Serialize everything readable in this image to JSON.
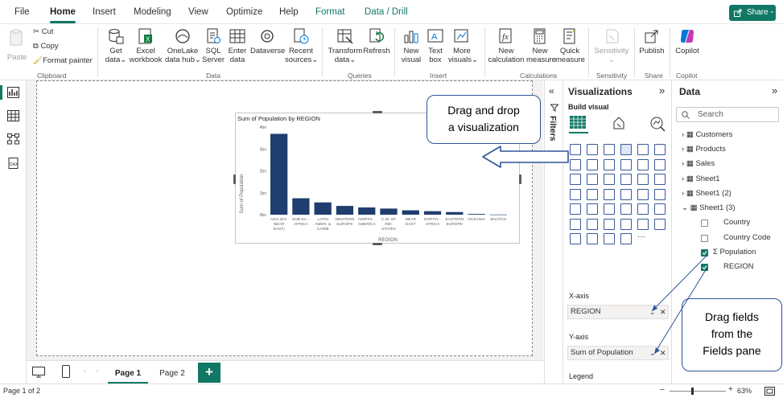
{
  "menu": {
    "items": [
      "File",
      "Home",
      "Insert",
      "Modeling",
      "View",
      "Optimize",
      "Help",
      "Format",
      "Data / Drill"
    ],
    "share_label": "Share"
  },
  "ribbon": {
    "clipboard": {
      "paste": "Paste",
      "cut": "Cut",
      "copy": "Copy",
      "format_painter": "Format painter",
      "label": "Clipboard"
    },
    "data": {
      "get_data": "Get",
      "get_data2": "data",
      "excel": "Excel",
      "excel2": "workbook",
      "onelake": "OneLake",
      "onelake2": "data hub",
      "sql": "SQL",
      "sql2": "Server",
      "enter": "Enter",
      "enter2": "data",
      "dataverse": "Dataverse",
      "recent": "Recent",
      "recent2": "sources",
      "label": "Data"
    },
    "queries": {
      "transform": "Transform",
      "transform2": "data",
      "refresh": "Refresh",
      "label": "Queries"
    },
    "insert": {
      "new_visual": "New",
      "new_visual2": "visual",
      "text_box": "Text",
      "text_box2": "box",
      "more": "More",
      "more2": "visuals",
      "label": "Insert"
    },
    "calculations": {
      "new_calc": "New",
      "new_calc2": "calculation",
      "new_measure": "New",
      "new_measure2": "measure",
      "quick": "Quick",
      "quick2": "measure",
      "label": "Calculations"
    },
    "sensitivity": {
      "btn": "Sensitivity",
      "label": "Sensitivity"
    },
    "share": {
      "publish": "Publish",
      "label": "Share"
    },
    "copilot": {
      "btn": "Copilot",
      "label": "Copilot"
    }
  },
  "chart_data": {
    "type": "bar",
    "title": "Sum of Population by REGION",
    "xlabel": "REGION",
    "ylabel": "Sum of Population",
    "ytick_labels": [
      "0bn",
      "1bn",
      "2bn",
      "3bn",
      "4bn"
    ],
    "ylim": [
      0,
      4
    ],
    "categories": [
      "ASIA (EX. NEAR EAST)",
      "SUB-SA... AFRICA",
      "LATIN AMER. & CARIB",
      "WESTERN EUROPE",
      "NORTH... AMERICA",
      "C.W. OF IND. STATES",
      "NEAR EAST",
      "NORTH... AFRICA",
      "EASTERN EUROPE",
      "OCEANIA",
      "BALTICS"
    ],
    "category_lines": [
      [
        "ASIA (EX.",
        "NEAR",
        "EAST)"
      ],
      [
        "SUB-SA...",
        "AFRICA"
      ],
      [
        "LATIN",
        "AMER. &",
        "CARIB"
      ],
      [
        "WESTERN",
        "EUROPE"
      ],
      [
        "NORTH...",
        "AMERICA"
      ],
      [
        "C.W. OF",
        "IND.",
        "STATES"
      ],
      [
        "NEAR",
        "EAST"
      ],
      [
        "NORTH...",
        "AFRICA"
      ],
      [
        "EASTERN",
        "EUROPE"
      ],
      [
        "OCEANIA"
      ],
      [
        "BALTICS"
      ]
    ],
    "values": [
      3.69,
      0.75,
      0.56,
      0.4,
      0.33,
      0.28,
      0.2,
      0.16,
      0.12,
      0.033,
      0.007
    ],
    "bar_color": "#1f3d6e",
    "grid": false,
    "legend": "none"
  },
  "pages": {
    "tabs": [
      "Page 1",
      "Page 2"
    ],
    "add_label": "+",
    "status": "Page 1 of 2"
  },
  "filters": {
    "label": "Filters"
  },
  "viz": {
    "title": "Visualizations",
    "build_label": "Build visual",
    "xaxis_label": "X-axis",
    "xaxis_value": "REGION",
    "yaxis_label": "Y-axis",
    "yaxis_value": "Sum of Population",
    "legend_label": "Legend",
    "more_glyph": "···"
  },
  "data_pane": {
    "title": "Data",
    "search_placeholder": "Search",
    "tables": [
      "Customers",
      "Products",
      "Sales",
      "Sheet1",
      "Sheet1 (2)",
      "Sheet1 (3)"
    ],
    "fields": [
      {
        "name": "Country",
        "checked": false
      },
      {
        "name": "Country Code",
        "checked": false
      },
      {
        "name": "Population",
        "checked": true
      },
      {
        "name": "REGION",
        "checked": true
      }
    ]
  },
  "zoom": {
    "value": "63%"
  },
  "callouts": {
    "drag_viz": [
      "Drag and drop",
      "a visualization"
    ],
    "drag_fields": [
      "Drag fields",
      "from the",
      "Fields pane"
    ]
  },
  "colors": {
    "accent": "#117865",
    "callout_border": "#2f5597",
    "arrow": "#2f5597"
  }
}
